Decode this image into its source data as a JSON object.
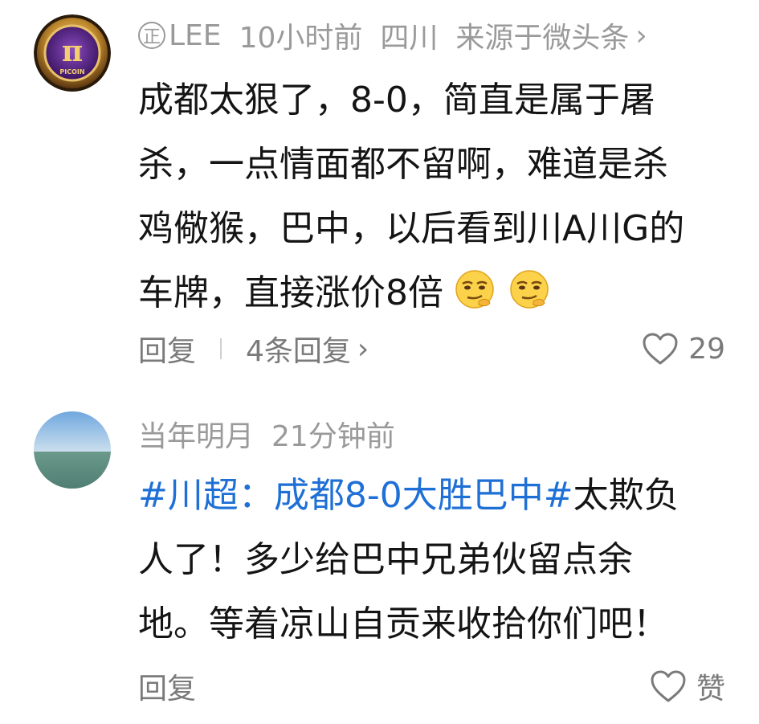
{
  "comments": [
    {
      "badge": "正",
      "username": "LEE",
      "time": "10小时前",
      "location": "四川",
      "source": "来源于微头条",
      "source_chevron": "›",
      "avatar_icon": "pi-coin-icon",
      "avatar_text": "PICOIN",
      "body_lines": [
        "成都太狠了，8-0，简直是属于屠",
        "杀，一点情面都不留啊，难道是杀",
        "鸡儆猴，巴中，以后看到川A川G的",
        "车牌，直接涨价8倍"
      ],
      "emojis": [
        "smirk-emoji",
        "smirk-emoji"
      ],
      "reply_label": "回复",
      "more_replies": "4条回复",
      "more_chevron": "›",
      "like_count": "29"
    },
    {
      "username": "当年明月",
      "time": "21分钟前",
      "avatar_icon": "sea-sky-avatar",
      "hashtag": "#川超：成都8-0大胜巴中#",
      "body_lines": [
        "太欺负",
        "人了！多少给巴中兄弟伙留点余",
        "地。等着凉山自贡来收拾你们吧！"
      ],
      "reply_label": "回复",
      "like_label": "赞"
    }
  ],
  "colors": {
    "text": "#141414",
    "meta": "#9a9a9a",
    "action": "#7a7a7a",
    "hashtag": "#1e6fd6"
  }
}
